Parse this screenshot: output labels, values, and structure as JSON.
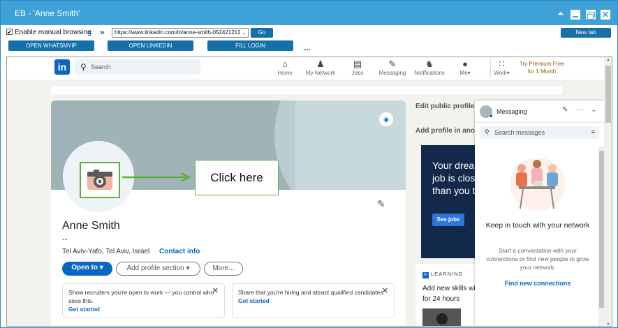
{
  "window": {
    "title": "EB - 'Anne Smith'"
  },
  "toolbar": {
    "enable_manual_label": "Enable manual browsing",
    "checked_mark": "✔",
    "back": "«",
    "forward": "»",
    "url": "https://www.linkedin.com/in/anne-smith-052421212",
    "go_label": "Go",
    "new_tab_label": "New tab",
    "open_whatsmyip": "OPEN WHATSMYIP",
    "open_linkedin": "OPEN LINKEDIN",
    "fill_login": "FILL LOGIN",
    "more_dots": "..."
  },
  "linkedin_nav": {
    "logo": "in",
    "search_placeholder": "Search",
    "items": [
      {
        "label": "Home",
        "icon": "home-icon"
      },
      {
        "label": "My Network",
        "icon": "network-icon"
      },
      {
        "label": "Jobs",
        "icon": "briefcase-icon"
      },
      {
        "label": "Messaging",
        "icon": "chat-icon"
      },
      {
        "label": "Notifications",
        "icon": "bell-icon"
      },
      {
        "label": "Me",
        "icon": "avatar-icon"
      },
      {
        "label": "Work",
        "icon": "grid-icon"
      }
    ],
    "premium_line1": "Try Premium Free",
    "premium_line2": "for 1 Month"
  },
  "profile": {
    "name": "Anne Smith",
    "headline": "--",
    "location": "Tel Aviv-Yafo, Tel Aviv, Israel",
    "contact_info": "Contact info",
    "open_to": "Open to",
    "add_section": "Add profile section",
    "more": "More...",
    "callout": "Click here"
  },
  "notices": [
    {
      "bold": "Show recruiters you're open to work",
      "rest": " — you control who sees this.",
      "link": "Get started"
    },
    {
      "bold": "Share that you're hiring",
      "rest": " and attract qualified candidates.",
      "link": "Get started"
    }
  ],
  "side": {
    "edit_public": "Edit public profile",
    "add_profile": "Add profile in ano",
    "ad_text": "Your dream job is closer than you think",
    "see_jobs": "See jobs",
    "learning": "LEARNING",
    "learning_body": "Add new skills with for 24 hours"
  },
  "messaging": {
    "title": "Messaging",
    "search_placeholder": "Search messages",
    "keep_title": "Keep in touch with your network",
    "keep_desc": "Start a conversation with your connections or find new people to grow your network.",
    "find_link": "Find new connections"
  },
  "colors": {
    "titlebar": "#3ea2d9",
    "button": "#156fa8",
    "linkedin_blue": "#0a66c2",
    "callout_green": "#5eae3b"
  }
}
